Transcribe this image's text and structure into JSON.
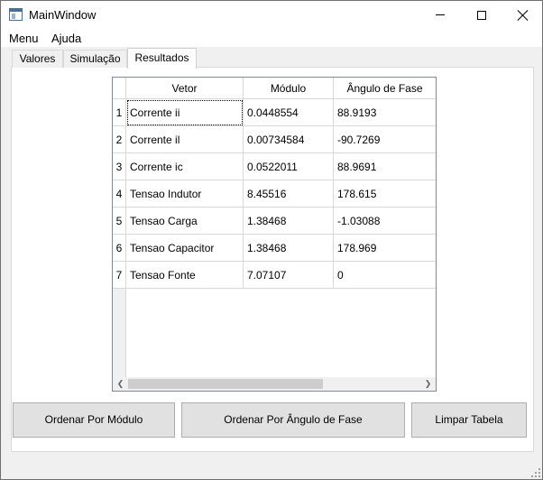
{
  "window": {
    "title": "MainWindow"
  },
  "menubar": {
    "items": [
      "Menu",
      "Ajuda"
    ]
  },
  "tabs": [
    {
      "label": "Valores",
      "active": false
    },
    {
      "label": "Simulação",
      "active": false
    },
    {
      "label": "Resultados",
      "active": true
    }
  ],
  "table": {
    "columns": [
      "Vetor",
      "Módulo",
      "Ângulo de Fase"
    ],
    "rows": [
      {
        "index": "1",
        "vetor": "Corrente ii",
        "modulo": "0.0448554",
        "angulo": "88.9193"
      },
      {
        "index": "2",
        "vetor": "Corrente il",
        "modulo": "0.00734584",
        "angulo": "-90.7269"
      },
      {
        "index": "3",
        "vetor": "Corrente ic",
        "modulo": "0.0522011",
        "angulo": "88.9691"
      },
      {
        "index": "4",
        "vetor": "Tensao Indutor",
        "modulo": "8.45516",
        "angulo": "178.615"
      },
      {
        "index": "5",
        "vetor": "Tensao Carga",
        "modulo": "1.38468",
        "angulo": "-1.03088"
      },
      {
        "index": "6",
        "vetor": "Tensao Capacitor",
        "modulo": "1.38468",
        "angulo": "178.969"
      },
      {
        "index": "7",
        "vetor": "Tensao Fonte",
        "modulo": "7.07107",
        "angulo": "0"
      }
    ]
  },
  "buttons": {
    "sort_modulo": "Ordenar Por Módulo",
    "sort_angulo": "Ordenar Por Ângulo de Fase",
    "clear": "Limpar Tabela"
  },
  "icons": {
    "app": "app-window-icon",
    "minimize": "minimize-icon",
    "maximize": "maximize-icon",
    "close": "close-icon",
    "scroll_left": "chevron-left-icon",
    "scroll_right": "chevron-right-icon",
    "resize_grip": "resize-grip-icon"
  },
  "colors": {
    "window_bg": "#f0f0f0",
    "button_bg": "#e1e1e1",
    "grid_line": "#d8d8d8"
  }
}
